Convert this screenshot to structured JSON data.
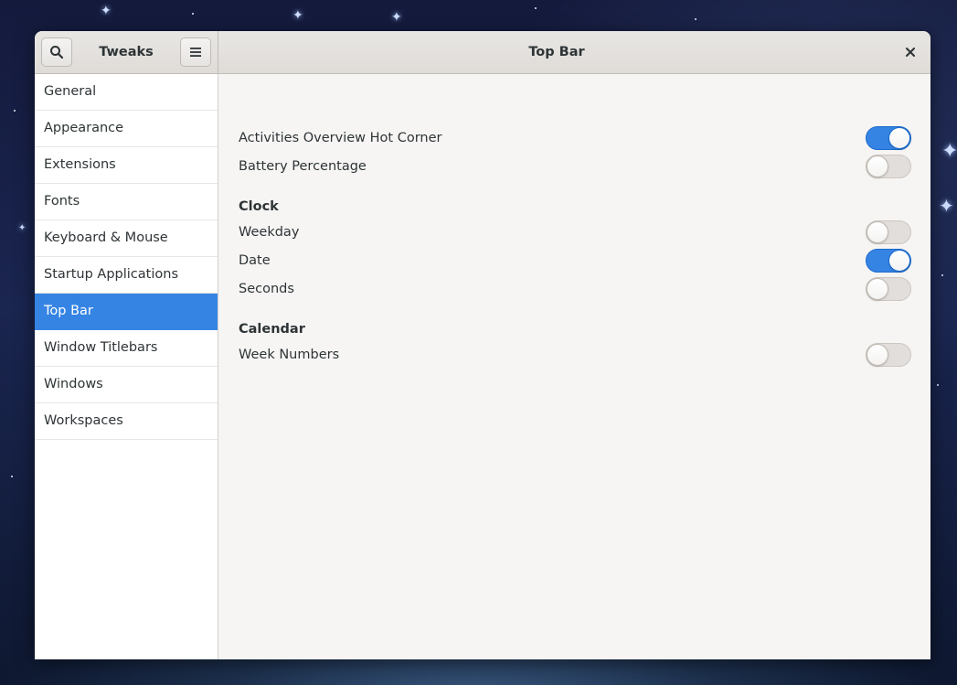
{
  "window": {
    "sidebar_title": "Tweaks",
    "page_title": "Top Bar"
  },
  "icons": {
    "search": "search-icon",
    "menu": "hamburger-menu-icon",
    "close": "close-icon"
  },
  "colors": {
    "accent": "#3584e4",
    "switch_off": "#e1dedb"
  },
  "sidebar": {
    "selected": "Top Bar",
    "items": [
      {
        "label": "General"
      },
      {
        "label": "Appearance"
      },
      {
        "label": "Extensions"
      },
      {
        "label": "Fonts"
      },
      {
        "label": "Keyboard & Mouse"
      },
      {
        "label": "Startup Applications"
      },
      {
        "label": "Top Bar"
      },
      {
        "label": "Window Titlebars"
      },
      {
        "label": "Windows"
      },
      {
        "label": "Workspaces"
      }
    ]
  },
  "settings": {
    "hot_corner": {
      "label": "Activities Overview Hot Corner",
      "enabled": true
    },
    "battery": {
      "label": "Battery Percentage",
      "enabled": false
    },
    "clock": {
      "title": "Clock",
      "weekday": {
        "label": "Weekday",
        "enabled": false
      },
      "date": {
        "label": "Date",
        "enabled": true
      },
      "seconds": {
        "label": "Seconds",
        "enabled": false
      }
    },
    "calendar": {
      "title": "Calendar",
      "week_numbers": {
        "label": "Week Numbers",
        "enabled": false
      }
    }
  }
}
